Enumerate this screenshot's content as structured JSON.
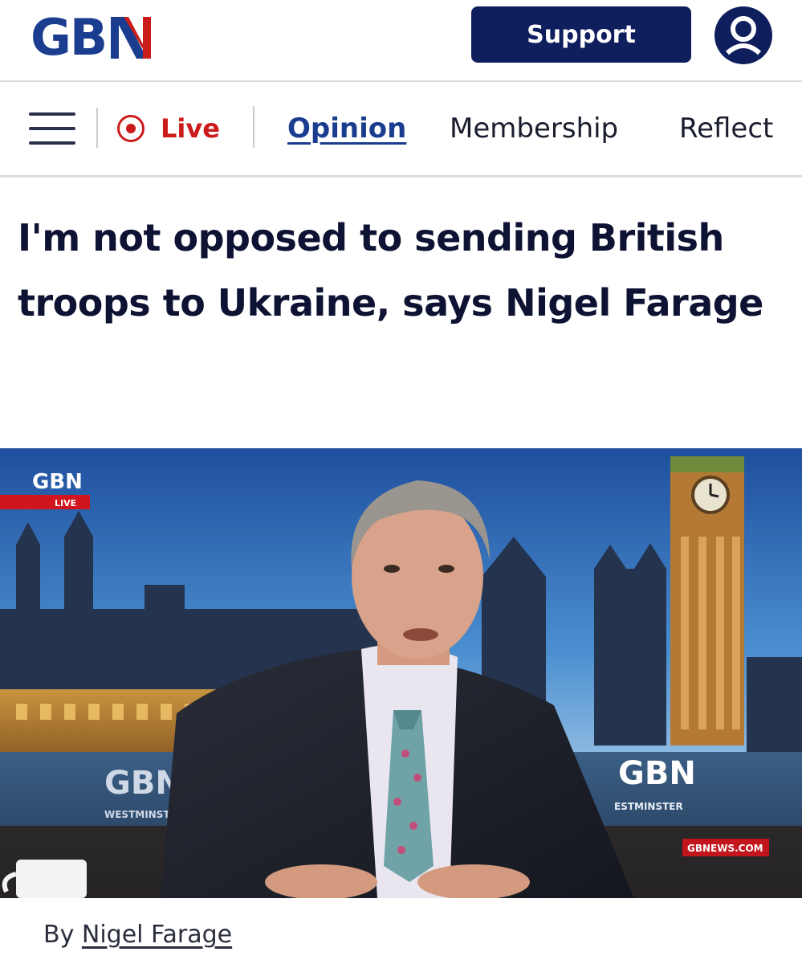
{
  "header": {
    "logo_text": "GB",
    "logo_flag_letter": "N",
    "support_label": "Support",
    "account_icon": "user-icon"
  },
  "nav": {
    "menu_icon": "hamburger-menu-icon",
    "live_icon": "live-record-icon",
    "live_label": "Live",
    "links": [
      {
        "label": "Opinion",
        "active": true
      },
      {
        "label": "Membership",
        "active": false
      },
      {
        "label": "Reflect",
        "active": false
      }
    ]
  },
  "article": {
    "headline": "I'm not opposed to sending British troops to Ukraine, says Nigel Farage",
    "hero": {
      "corner_logo": "GBN",
      "live_badge": "LIVE",
      "desk_logo_left": "GBN",
      "desk_sub_left": "WESTMINSTER",
      "desk_logo_right": "GBN",
      "desk_sub_right": "ESTMINSTER",
      "url_badge": "GBNEWS.COM"
    },
    "byline_prefix": "By",
    "author": "Nigel Farage"
  },
  "colors": {
    "brand_navy": "#1b3d8f",
    "button_navy": "#0f1e5c",
    "live_red": "#cc1b1b",
    "headline": "#0e1233"
  }
}
